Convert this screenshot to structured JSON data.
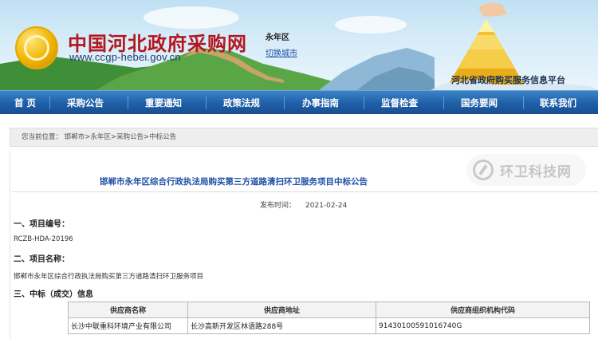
{
  "header": {
    "site_title": "中国河北政府采购网",
    "site_url": "www.ccgp-hebei.gov.cn",
    "region": "永年区",
    "switch_city": "切换城市",
    "platform_name": "河北省政府购买服务信息平台"
  },
  "nav": {
    "items": [
      "首 页",
      "采购公告",
      "重要通知",
      "政策法规",
      "办事指南",
      "监督检查",
      "国务要闻",
      "联系我们"
    ]
  },
  "breadcrumb": {
    "prefix": "您当前位置：",
    "crumbs": [
      "邯郸市",
      "永年区",
      "采购公告",
      "中标公告"
    ],
    "separator": ">"
  },
  "article": {
    "title": "邯郸市永年区综合行政执法局购买第三方道路清扫环卫服务项目中标公告",
    "publish_label": "发布时间：",
    "publish_date": "2021-02-24",
    "sections": [
      {
        "heading": "一、项目编号：",
        "text": "RCZB-HDA-20196"
      },
      {
        "heading": "二、项目名称：",
        "text": "邯郸市永年区综合行政执法局购买第三方道路清扫环卫服务项目"
      },
      {
        "heading": "三、中标（成交）信息",
        "text": ""
      }
    ]
  },
  "table": {
    "headers": [
      "供应商名称",
      "供应商地址",
      "供应商组织机构代码"
    ],
    "rows": [
      [
        "长沙中联重科环境产业有限公司",
        "长沙高新开发区林语路288号",
        "91430100591016740G"
      ]
    ]
  },
  "watermark": {
    "text": "环卫科技网"
  },
  "colors": {
    "title_red": "#b3161e",
    "nav_blue": "#1f5fa8",
    "article_title_blue": "#1e4fa5"
  }
}
